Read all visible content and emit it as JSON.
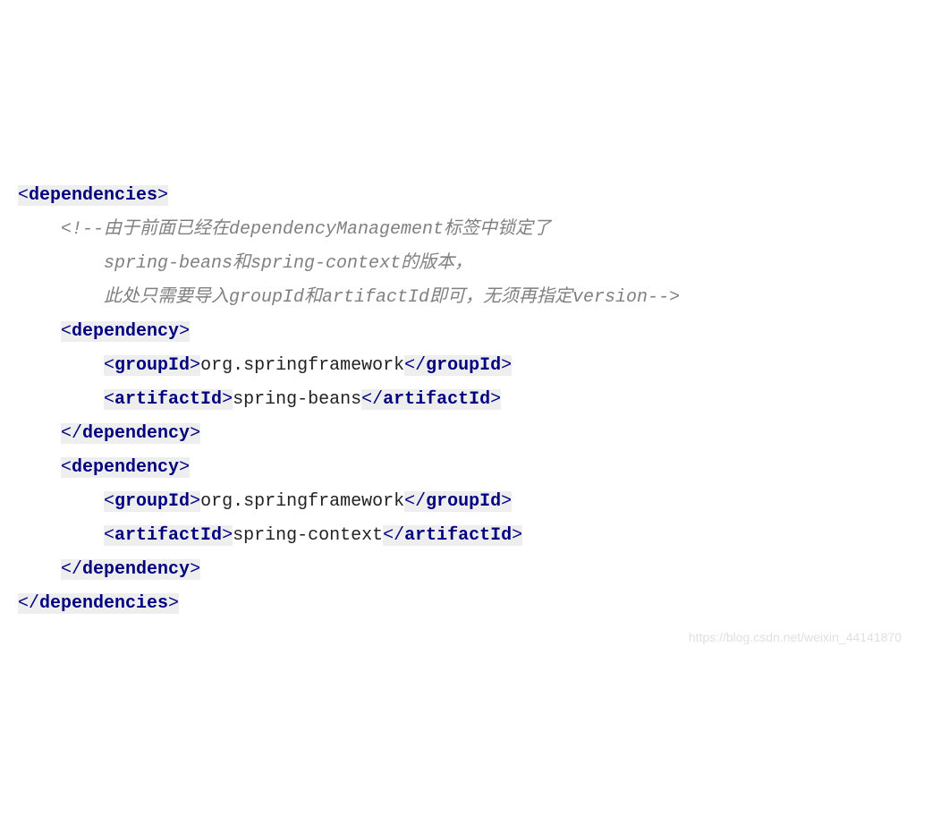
{
  "code": {
    "root_open": "dependencies",
    "root_close": "dependencies",
    "comment_l1": "<!--由于前面已经在dependencyManagement标签中锁定了",
    "comment_l2": "spring-beans和spring-context的版本，",
    "comment_l3": "此处只需要导入groupId和artifactId即可，无须再指定version-->",
    "dep_open": "dependency",
    "dep_close": "dependency",
    "groupId_tag": "groupId",
    "artifactId_tag": "artifactId",
    "groupId_val": "org.springframework",
    "artifact1": "spring-beans",
    "artifact2": "spring-context"
  },
  "watermark": "https://blog.csdn.net/weixin_44141870"
}
